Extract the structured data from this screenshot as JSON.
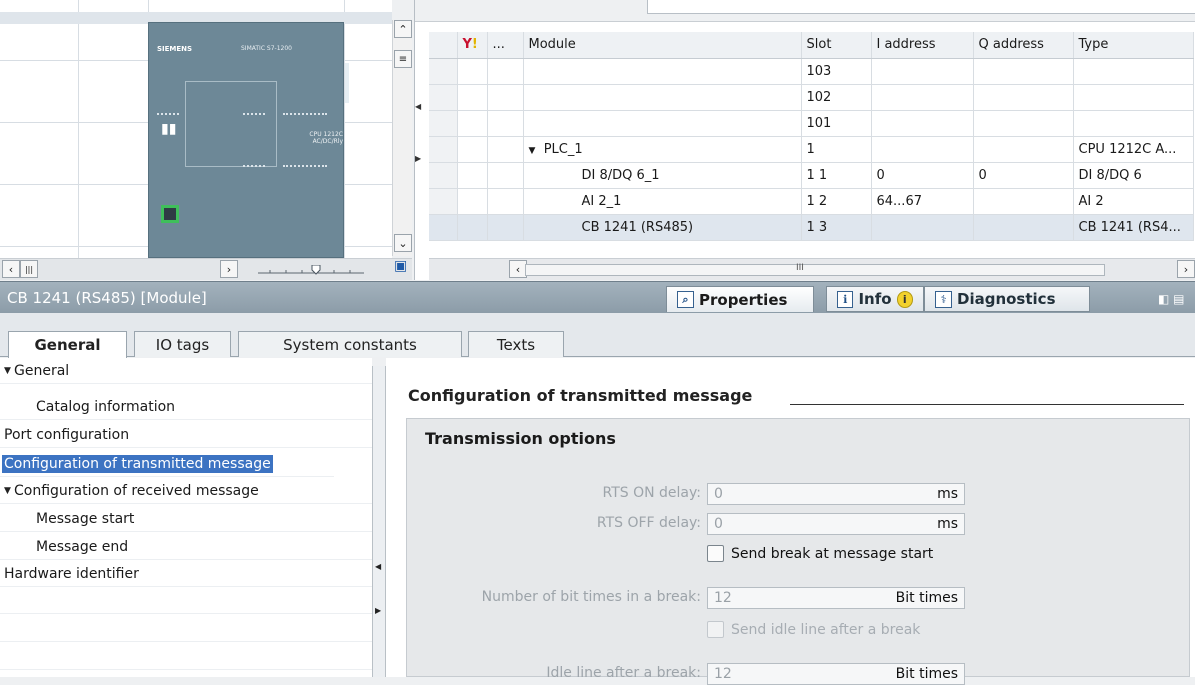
{
  "device_view": {
    "plc_brand": "SIEMENS",
    "plc_model": "SIMATIC S7-1200",
    "plc_io_label": "CPU 1212C AC/DC/Rly"
  },
  "overview_table": {
    "columns": [
      "",
      "...",
      "Module",
      "Slot",
      "I address",
      "Q address",
      "Type"
    ],
    "rows": [
      {
        "module": "",
        "slot": "103",
        "i_address": "",
        "q_address": "",
        "type": ""
      },
      {
        "module": "",
        "slot": "102",
        "i_address": "",
        "q_address": "",
        "type": ""
      },
      {
        "module": "",
        "slot": "101",
        "i_address": "",
        "q_address": "",
        "type": ""
      },
      {
        "module": "PLC_1",
        "slot": "1",
        "i_address": "",
        "q_address": "",
        "type": "CPU 1212C A..."
      },
      {
        "module": "DI 8/DQ 6_1",
        "slot": "1 1",
        "i_address": "0",
        "q_address": "0",
        "type": "DI 8/DQ 6"
      },
      {
        "module": "AI 2_1",
        "slot": "1 2",
        "i_address": "64...67",
        "q_address": "",
        "type": "AI 2"
      },
      {
        "module": "CB 1241 (RS485)",
        "slot": "1 3",
        "i_address": "",
        "q_address": "",
        "type": "CB 1241 (RS4..."
      }
    ],
    "scroll_indicator": "III"
  },
  "inspector": {
    "title": "CB 1241 (RS485) [Module]",
    "tabs": {
      "properties": "Properties",
      "info": "Info",
      "info_badge": "i",
      "diagnostics": "Diagnostics"
    }
  },
  "property_tabs": [
    "General",
    "IO tags",
    "System constants",
    "Texts"
  ],
  "nav_tree": [
    {
      "label": "General",
      "indent": 0,
      "caret": true
    },
    {
      "label": "Catalog information",
      "indent": 1,
      "caret": false
    },
    {
      "label": "Port configuration",
      "indent": 0,
      "caret": false
    },
    {
      "label": "Configuration of transmitted message",
      "indent": 0,
      "caret": false,
      "selected": true
    },
    {
      "label": "Configuration of received message",
      "indent": 0,
      "caret": true
    },
    {
      "label": "Message start",
      "indent": 1,
      "caret": false
    },
    {
      "label": "Message end",
      "indent": 1,
      "caret": false
    },
    {
      "label": "Hardware identifier",
      "indent": 0,
      "caret": false
    }
  ],
  "settings": {
    "section_title": "Configuration of transmitted message",
    "group_title": "Transmission options",
    "rts_on_label": "RTS ON delay:",
    "rts_on_value": "0",
    "rts_on_unit": "ms",
    "rts_off_label": "RTS OFF delay:",
    "rts_off_value": "0",
    "rts_off_unit": "ms",
    "send_break_label": "Send break at message start",
    "bit_times_label": "Number of bit times in a break:",
    "bit_times_value": "12",
    "bit_times_unit": "Bit times",
    "send_idle_label": "Send idle line after a break",
    "idle_line_label": "Idle line after a break:",
    "idle_line_value": "12",
    "idle_line_unit": "Bit times"
  },
  "colors": {
    "selection": "#3c73c2",
    "inspector_bar": "#97a6b2",
    "plc_body": "#6d8897",
    "port_highlight": "#3fbf5b"
  }
}
